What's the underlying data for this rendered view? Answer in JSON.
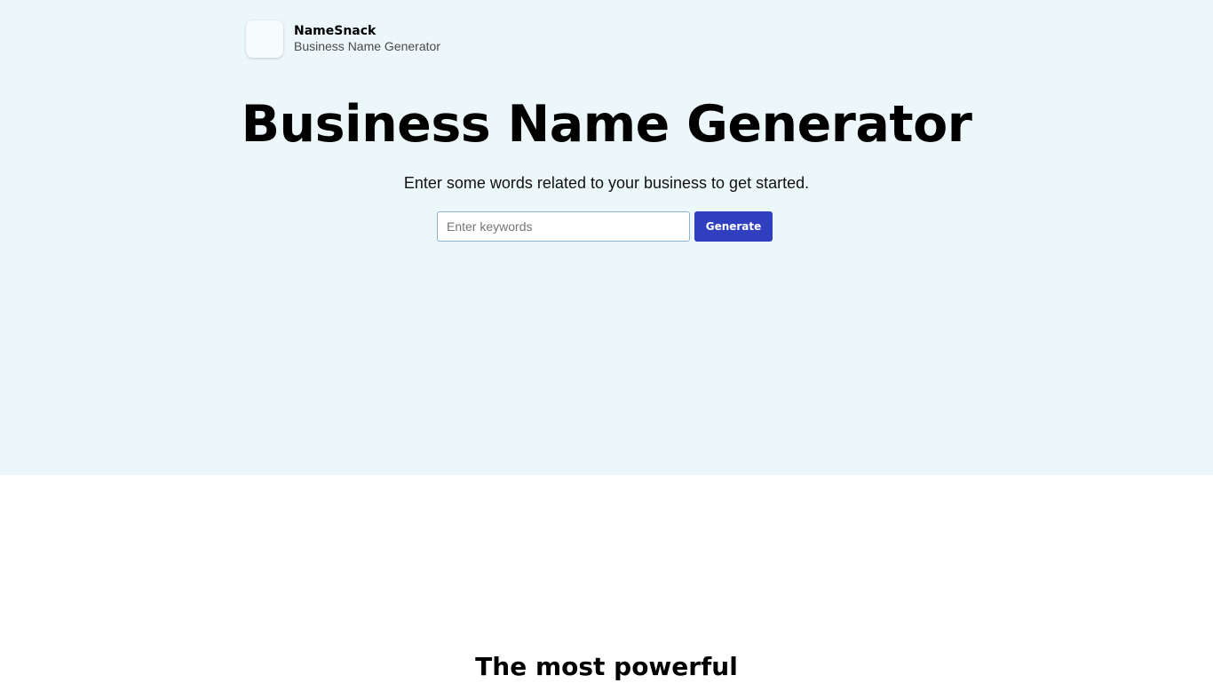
{
  "brand": {
    "name": "NameSnack",
    "tagline": "Business Name Generator"
  },
  "hero": {
    "title": "Business Name Generator",
    "subtitle": "Enter some words related to your business to get started.",
    "search": {
      "placeholder": "Enter keywords",
      "value": ""
    },
    "generate_label": "Generate"
  },
  "section": {
    "title": "The most powerful"
  },
  "colors": {
    "hero_background": "#ecf7fa",
    "button": "#2f3fc0"
  }
}
